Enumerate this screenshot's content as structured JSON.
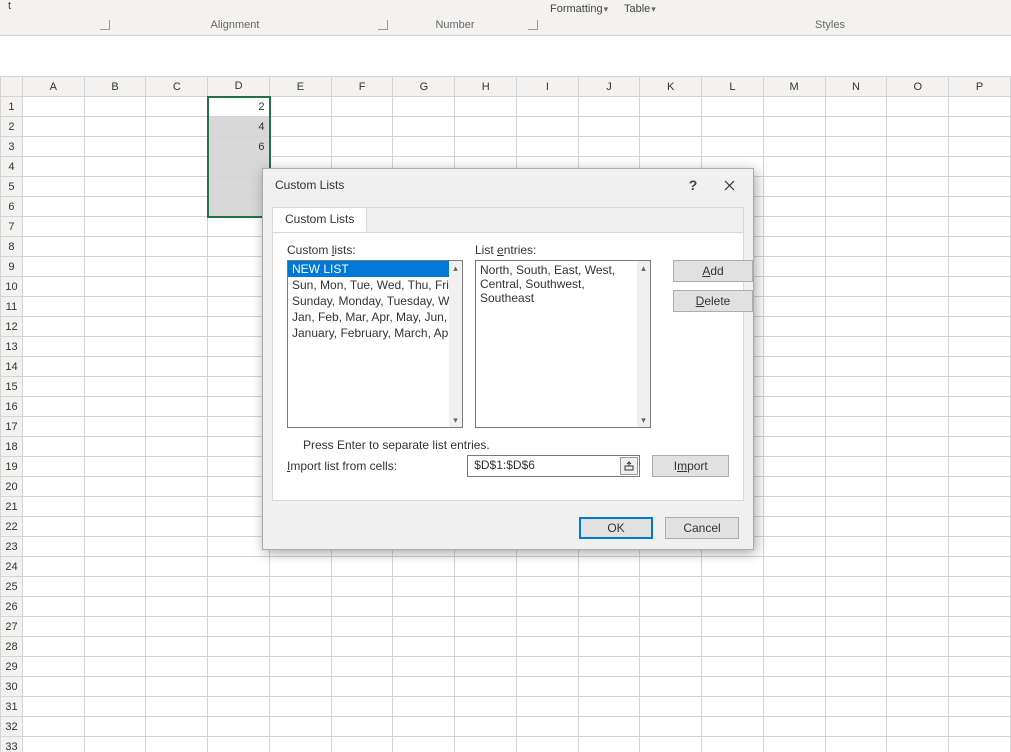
{
  "ribbon": {
    "alignment_label": "Alignment",
    "number_label": "Number",
    "styles_label": "Styles",
    "formatting_label": "Formatting",
    "table_label": "Table"
  },
  "columns": [
    "A",
    "B",
    "C",
    "D",
    "E",
    "F",
    "G",
    "H",
    "I",
    "J",
    "K",
    "L",
    "M",
    "N",
    "O",
    "P"
  ],
  "rows": 33,
  "cells": {
    "D1": "2",
    "D2": "4",
    "D3": "6"
  },
  "dialog": {
    "title": "Custom Lists",
    "tab": "Custom Lists",
    "custom_lists_label": "Custom lists:",
    "list_entries_label": "List entries:",
    "lists": [
      "NEW LIST",
      "Sun, Mon, Tue, Wed, Thu, Fri, ",
      "Sunday, Monday, Tuesday, We",
      "Jan, Feb, Mar, Apr, May, Jun, Ju",
      "January, February, March, Apri"
    ],
    "selected_list_index": 0,
    "entries_text": "North, South, East, West, Central, Southwest, Southeast",
    "add_label": "Add",
    "delete_label": "Delete",
    "note": "Press Enter to separate list entries.",
    "import_label": "Import list from cells:",
    "import_ref": "$D$1:$D$6",
    "import_btn": "Import",
    "ok": "OK",
    "cancel": "Cancel"
  }
}
